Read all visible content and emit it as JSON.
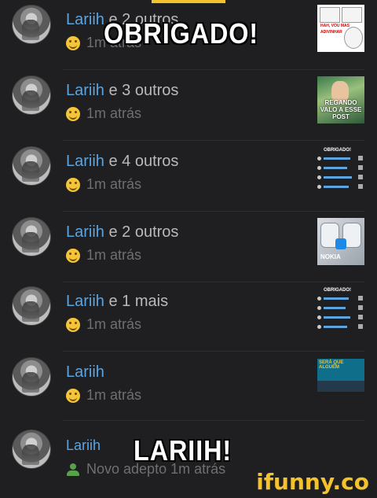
{
  "overlay": {
    "top_caption": "OBRIGADO!",
    "bottom_caption": "LARIIH!",
    "watermark": "ifunny.co"
  },
  "notifications": [
    {
      "name": "Lariih",
      "rest": " e 2 outros",
      "time": "1m atrás",
      "icon": "smile-emoji-icon",
      "thumb": "meme-thumbnail"
    },
    {
      "name": "Lariih",
      "rest": " e 3 outros",
      "time": "1m atrás",
      "icon": "smile-emoji-icon",
      "thumb": "photo-thumbnail",
      "thumb_caption": "REGANDO VALO A ESSE POST"
    },
    {
      "name": "Lariih",
      "rest": " e 4 outros",
      "time": "1m atrás",
      "icon": "smile-emoji-icon",
      "thumb": "list-thumbnail",
      "thumb_caption": "OBRIGADO!"
    },
    {
      "name": "Lariih",
      "rest": " e 2 outros",
      "time": "1m atrás",
      "icon": "smile-emoji-icon",
      "thumb": "nokia-thumbnail",
      "thumb_caption": "NOKIA"
    },
    {
      "name": "Lariih",
      "rest": " e 1 mais",
      "time": "1m atrás",
      "icon": "smile-emoji-icon",
      "thumb": "list-thumbnail",
      "thumb_caption": "OBRIGADO!"
    },
    {
      "name": "Lariih",
      "rest": "",
      "time": "1m atrás",
      "icon": "smile-emoji-icon",
      "thumb": "post-thumbnail",
      "thumb_caption": "SERÁ QUE ALGUÉM"
    },
    {
      "name": "Lariih",
      "rest": "",
      "time": "Novo adepto 1m atrás",
      "icon": "new-follower-icon"
    }
  ],
  "colors": {
    "background": "#1f1f21",
    "accent": "#f3c22c",
    "username": "#5ba4e0",
    "muted": "#6f6f72"
  }
}
